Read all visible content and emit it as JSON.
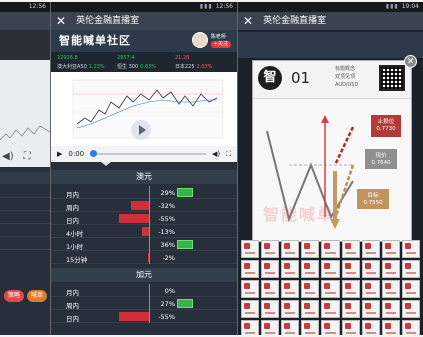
{
  "status_bar": {
    "time_left": "12:56",
    "time_mid": "12:56",
    "time_right": "19:04"
  },
  "app": {
    "title": "英伦金融直播室",
    "close_symbol": "✕"
  },
  "banner": {
    "title": "智能喊单社区"
  },
  "host": {
    "name": "陈老师",
    "follow_label": "+关注"
  },
  "quotes": [
    {
      "value": "12926.8",
      "name": "澳大利亚A50",
      "change": "1.23%",
      "direction": "up"
    },
    {
      "value": "2957.4",
      "name": "恒生 300",
      "change": "0.63%",
      "direction": "up"
    },
    {
      "value": "21.28",
      "name": "日本225",
      "change": "2.03%",
      "direction": "down"
    }
  ],
  "video": {
    "time": "0:00",
    "play_icon": "play-icon",
    "volume_icon": "volume-icon",
    "fullscreen_icon": "fullscreen-icon"
  },
  "sentiment": {
    "sections": [
      {
        "title": "澳元",
        "rows": [
          {
            "label": "月内",
            "value": 29
          },
          {
            "label": "周内",
            "value": -32
          },
          {
            "label": "日内",
            "value": -55
          },
          {
            "label": "4小时",
            "value": -13
          },
          {
            "label": "1小时",
            "value": 36
          },
          {
            "label": "15分钟",
            "value": -2
          }
        ]
      },
      {
        "title": "加元",
        "rows": [
          {
            "label": "月内",
            "value": 0
          },
          {
            "label": "周内",
            "value": 27
          },
          {
            "label": "日内",
            "value": -55
          }
        ]
      }
    ]
  },
  "left_phone": {
    "button_a": "策略",
    "button_b": "喊单"
  },
  "modal": {
    "badge": "智",
    "number": "01",
    "meta": [
      "标题概念",
      "双顶见顶",
      "AUD/USD"
    ],
    "levels": [
      {
        "label": "止损位",
        "value": "0.7730",
        "color": "#b43a3a"
      },
      {
        "label": "现价",
        "value": "0.7640",
        "color": "#8f8f8f"
      },
      {
        "label": "目标",
        "value": "0.7550",
        "color": "#c0955d"
      }
    ],
    "watermark": "智能喊单"
  },
  "colors": {
    "up": "#31c45a",
    "down": "#d1303a",
    "accent": "#2f7de1"
  }
}
